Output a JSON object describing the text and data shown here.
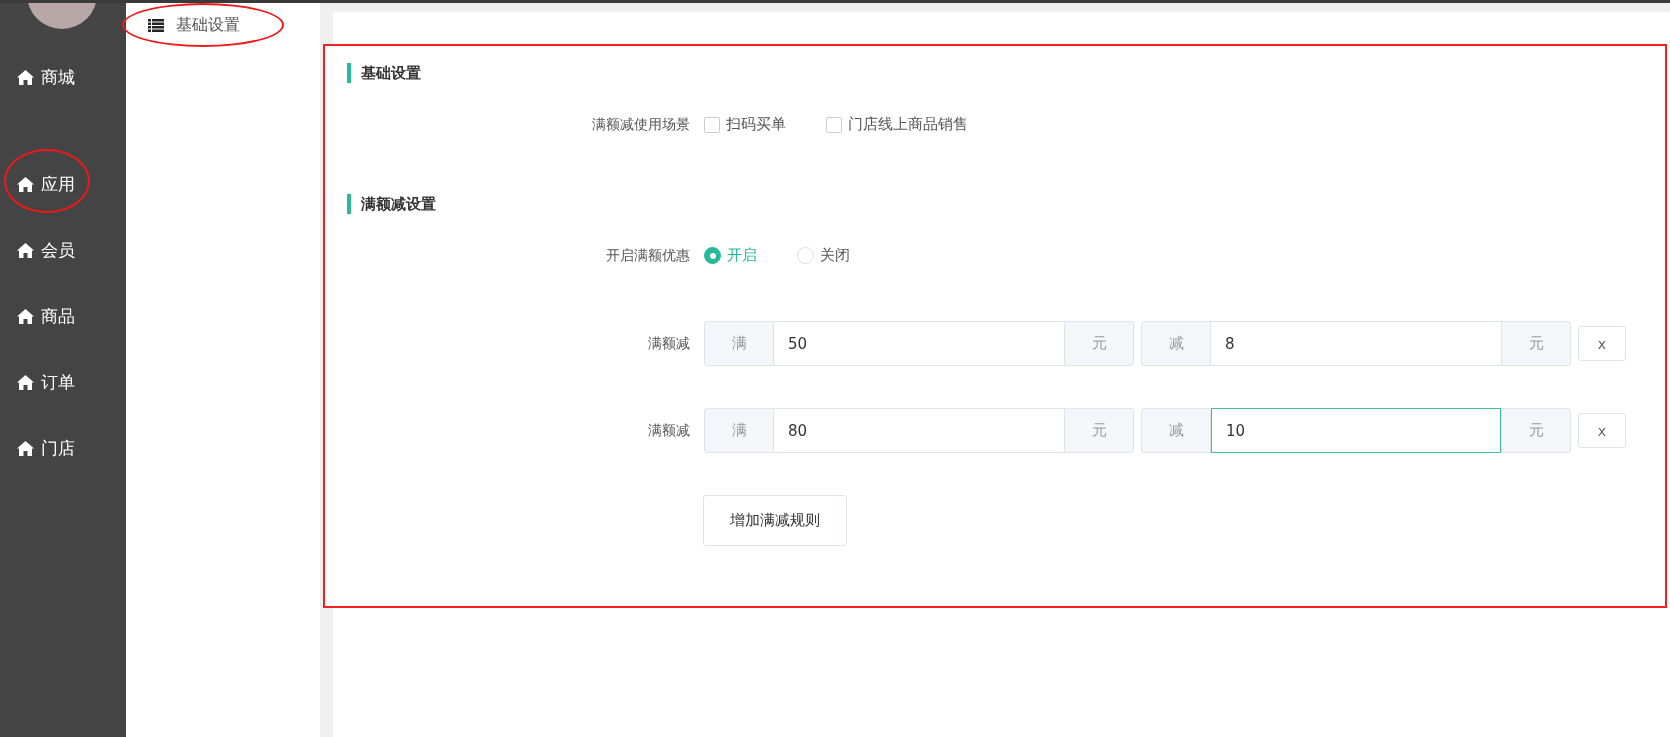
{
  "sidebar": {
    "items": [
      {
        "label": "商城",
        "circled": false
      },
      {
        "label": "应用",
        "circled": true
      },
      {
        "label": "会员",
        "circled": false
      },
      {
        "label": "商品",
        "circled": false
      },
      {
        "label": "订单",
        "circled": false
      },
      {
        "label": "门店",
        "circled": false
      }
    ]
  },
  "subnav": {
    "items": [
      {
        "label": "基础设置",
        "circled": true
      }
    ]
  },
  "form": {
    "outlined": true,
    "sections": [
      {
        "title": "基础设置",
        "fields": [
          {
            "kind": "checkboxes",
            "label": "满额减使用场景",
            "options": [
              {
                "label": "扫码买单",
                "checked": false
              },
              {
                "label": "门店线上商品销售",
                "checked": false
              }
            ]
          }
        ]
      },
      {
        "title": "满额减设置",
        "fields": [
          {
            "kind": "radio",
            "label": "开启满额优惠",
            "options": [
              {
                "label": "开启",
                "selected": true
              },
              {
                "label": "关闭",
                "selected": false
              }
            ]
          },
          {
            "kind": "rule",
            "label": "满额减",
            "threshold_prefix": "满",
            "threshold": "50",
            "threshold_suffix": "元",
            "threshold_focused": false,
            "discount_prefix": "减",
            "discount": "8",
            "discount_suffix": "元",
            "discount_focused": false,
            "remove": "x"
          },
          {
            "kind": "rule",
            "label": "满额减",
            "threshold_prefix": "满",
            "threshold": "80",
            "threshold_suffix": "元",
            "threshold_focused": false,
            "discount_prefix": "减",
            "discount": "10",
            "discount_suffix": "元",
            "discount_focused": true,
            "remove": "x"
          },
          {
            "kind": "button",
            "label": "增加满减规则"
          }
        ]
      }
    ]
  }
}
